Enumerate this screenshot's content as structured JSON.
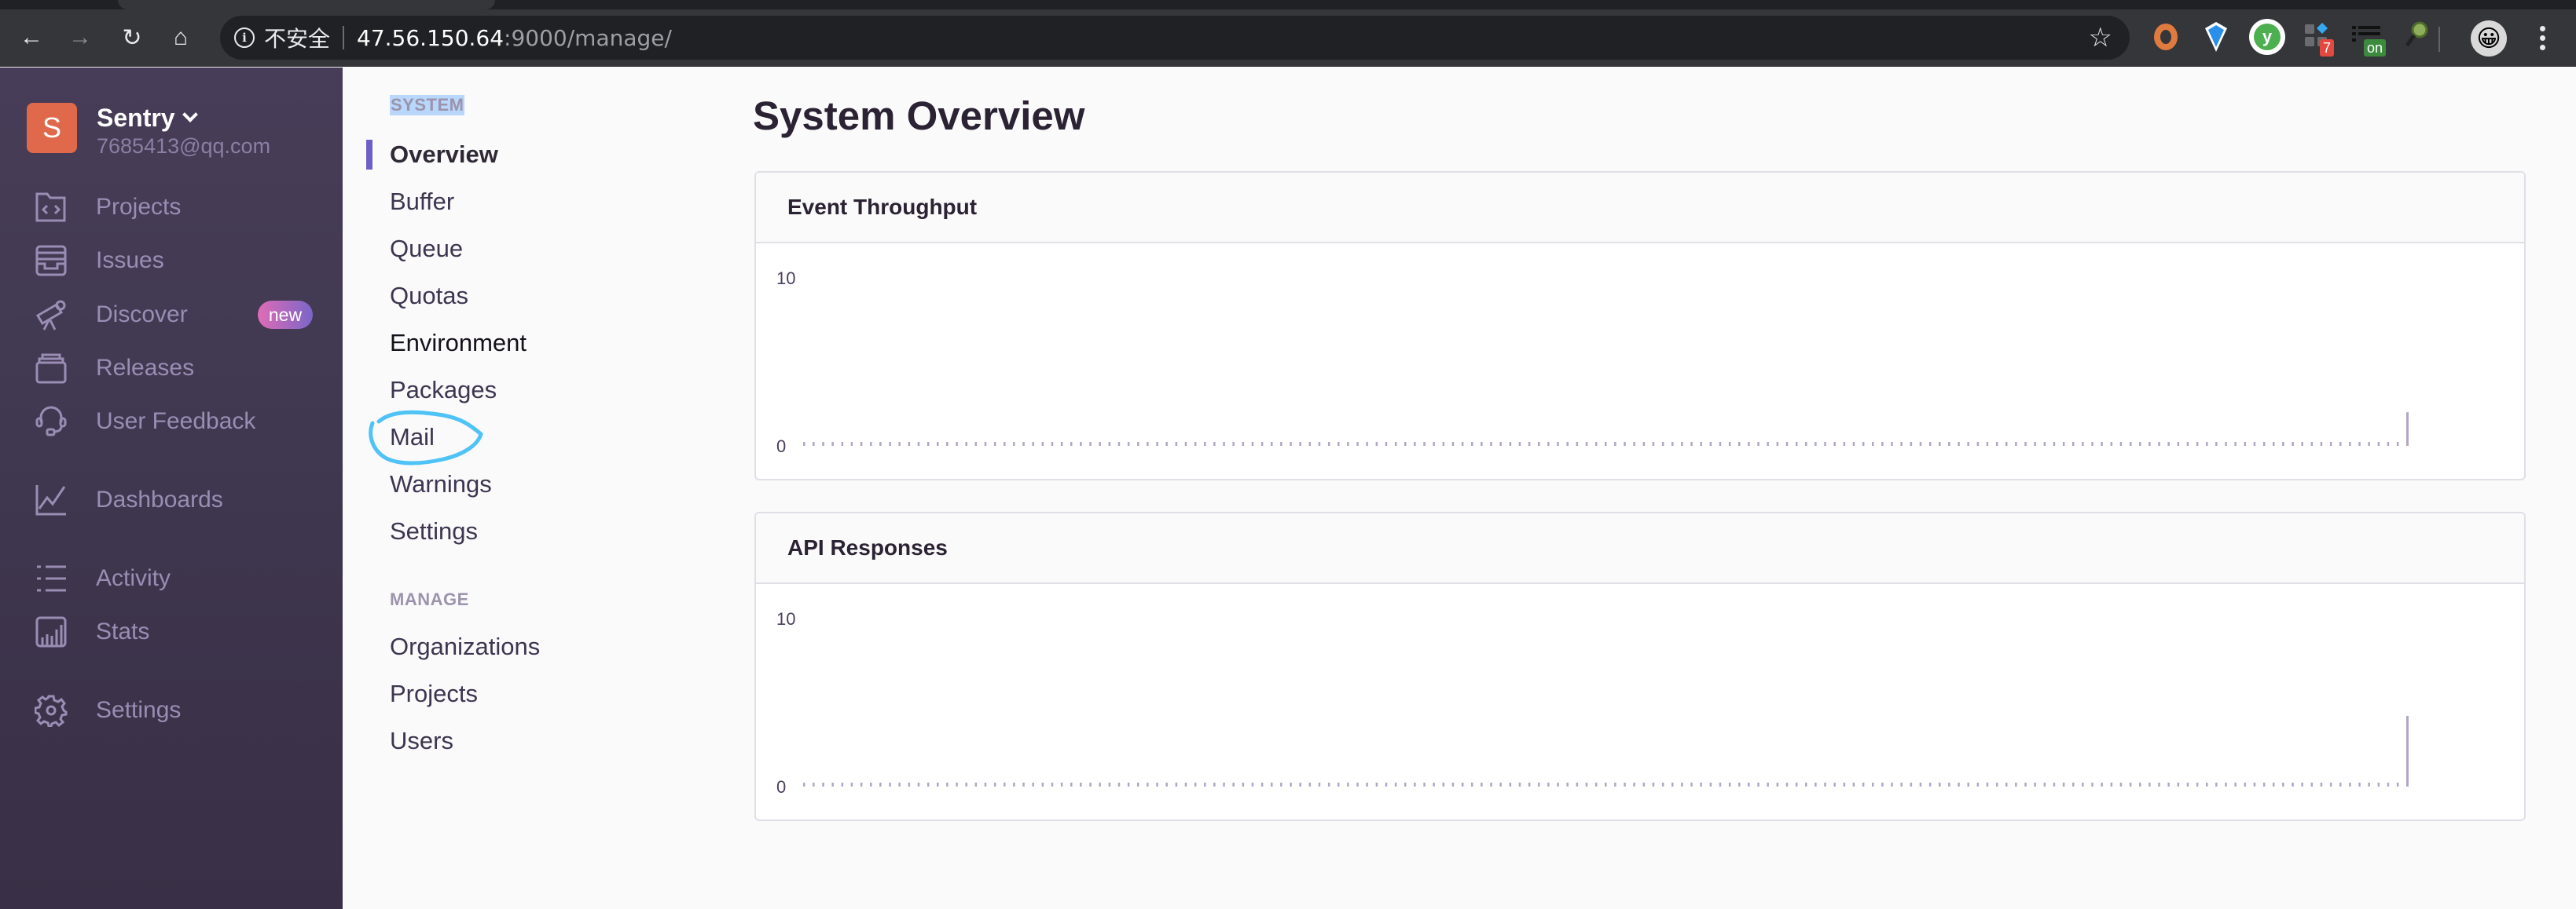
{
  "browser": {
    "insecure_label": "不安全",
    "url_host": "47.56.150.64",
    "url_rest": ":9000/manage/",
    "extensions": [
      {
        "name": "ring-extension-icon"
      },
      {
        "name": "diamond-extension-icon"
      },
      {
        "name": "y-extension-icon",
        "glyph": "y"
      },
      {
        "name": "grid-extension-icon",
        "badge": "7",
        "badge_color": "#e5483f"
      },
      {
        "name": "list-extension-icon",
        "badge": "on",
        "badge_color": "#3c8a3e"
      },
      {
        "name": "magnifier-extension-icon"
      }
    ],
    "profile_emoji": "😀"
  },
  "sidebar": {
    "org_initial": "S",
    "org_name": "Sentry",
    "org_email": "7685413@qq.com",
    "items": [
      {
        "label": "Projects",
        "icon": "projects-icon"
      },
      {
        "label": "Issues",
        "icon": "issues-icon"
      },
      {
        "label": "Discover",
        "icon": "discover-icon",
        "badge": "new"
      },
      {
        "label": "Releases",
        "icon": "releases-icon"
      },
      {
        "label": "User Feedback",
        "icon": "user-feedback-icon"
      },
      {
        "label": "Dashboards",
        "icon": "dashboards-icon"
      },
      {
        "label": "Activity",
        "icon": "activity-icon"
      },
      {
        "label": "Stats",
        "icon": "stats-icon"
      },
      {
        "label": "Settings",
        "icon": "settings-icon"
      }
    ]
  },
  "subnav": {
    "system_heading": "SYSTEM",
    "system_items": [
      "Overview",
      "Buffer",
      "Queue",
      "Quotas",
      "Environment",
      "Packages",
      "Mail",
      "Warnings",
      "Settings"
    ],
    "active_item": "Overview",
    "manage_heading": "MANAGE",
    "manage_items": [
      "Organizations",
      "Projects",
      "Users"
    ]
  },
  "main": {
    "title": "System Overview"
  },
  "colors": {
    "accent": "#6c5fc7",
    "bar": "#b1a6c4",
    "annotation": "#4fc3f7"
  },
  "chart_data": [
    {
      "type": "bar",
      "title": "Event Throughput",
      "ylim": [
        0,
        10
      ],
      "yticks": [
        "0",
        "10"
      ],
      "bar_count": 169,
      "nonzero_bars": [
        {
          "index": 168,
          "value": 2
        }
      ],
      "xlabel": "",
      "ylabel": "",
      "grid": false
    },
    {
      "type": "bar",
      "title": "API Responses",
      "ylim": [
        0,
        10
      ],
      "yticks": [
        "0",
        "10"
      ],
      "bar_count": 169,
      "nonzero_bars": [
        {
          "index": 168,
          "value": 4.2
        }
      ],
      "xlabel": "",
      "ylabel": "",
      "grid": false
    }
  ]
}
